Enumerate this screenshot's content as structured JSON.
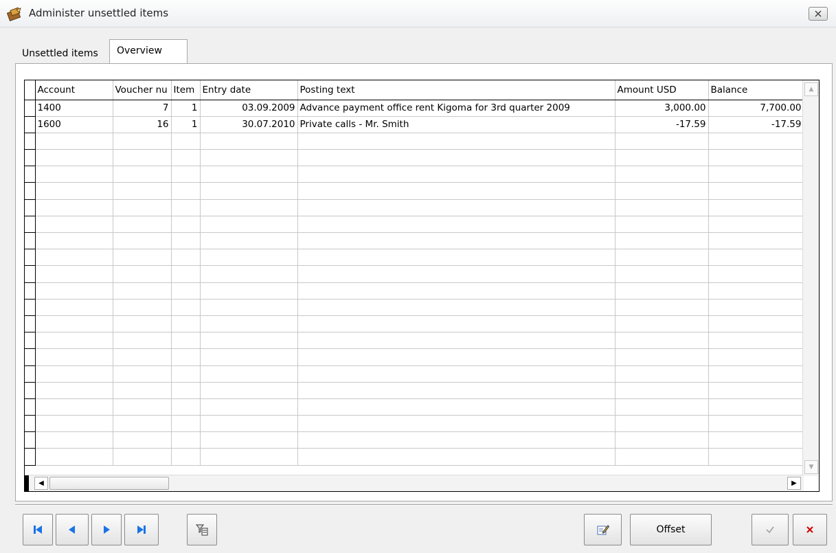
{
  "window": {
    "title": "Administer unsettled items",
    "accent": "#1a73e8"
  },
  "tabs": [
    {
      "label": "Unsettled items",
      "active": false
    },
    {
      "label": "Overview",
      "active": true
    }
  ],
  "grid": {
    "columns": [
      "Account",
      "Voucher nu",
      "Item",
      "Entry date",
      "Posting text",
      "Amount USD",
      "Balance"
    ],
    "rows": [
      {
        "account": "1400",
        "voucher": "7",
        "item": "1",
        "entry_date": "03.09.2009",
        "posting_text": "Advance payment office rent Kigoma for 3rd quarter 2009",
        "amount": "3,000.00",
        "balance": "7,700.00"
      },
      {
        "account": "1600",
        "voucher": "16",
        "item": "1",
        "entry_date": "30.07.2010",
        "posting_text": "Private calls - Mr. Smith",
        "amount": "-17.59",
        "balance": "-17.59"
      }
    ],
    "empty_row_count": 20
  },
  "toolbar": {
    "first_icon": "first-record-icon",
    "prev_icon": "previous-record-icon",
    "next_icon": "next-record-icon",
    "last_icon": "last-record-icon",
    "filter_icon": "filter-icon",
    "edit_icon": "edit-icon",
    "offset_label": "Offset",
    "ok_icon": "checkmark-icon",
    "cancel_icon": "cancel-icon",
    "cancel_color": "#d40000"
  }
}
